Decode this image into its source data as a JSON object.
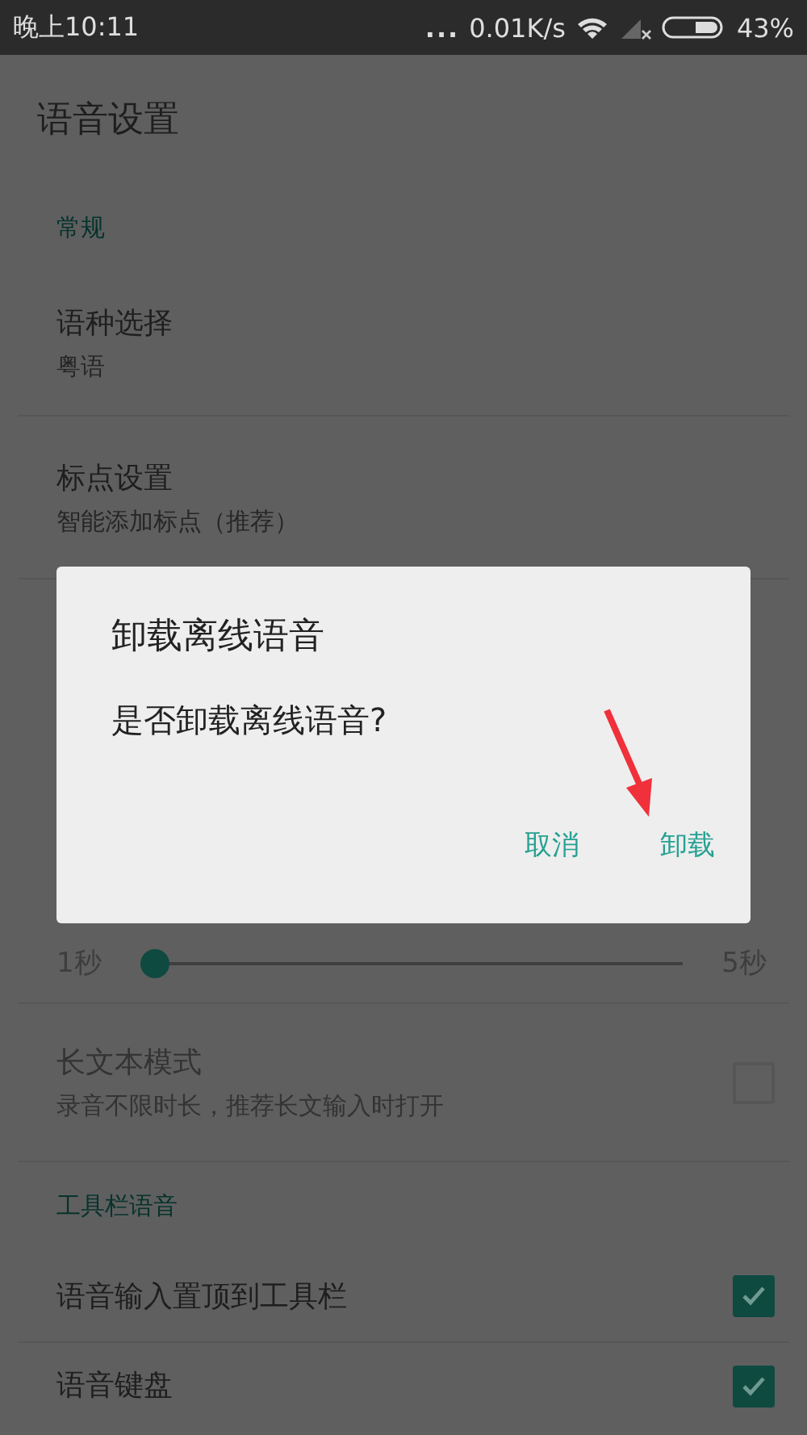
{
  "status_bar": {
    "time": "晚上10:11",
    "more": "...",
    "speed": "0.01K/s",
    "battery": "43%"
  },
  "title": "语音设置",
  "rows": [
    {
      "kind": "header",
      "title": "常规"
    },
    {
      "kind": "item",
      "title": "语种选择",
      "subtitle": "粤语"
    },
    {
      "kind": "item",
      "title": "标点设置",
      "subtitle": "智能添加标点（推荐）"
    },
    {
      "kind": "covered"
    },
    {
      "kind": "slider",
      "min_label": "1秒",
      "max_label": "5秒",
      "level": 0
    },
    {
      "kind": "toggle",
      "title": "长文本模式",
      "subtitle": "录音不限时长，推荐长文输入时打开",
      "checked": false,
      "disabled": true
    },
    {
      "kind": "header",
      "title": "工具栏语音"
    },
    {
      "kind": "toggle",
      "title": "语音输入置顶到工具栏",
      "checked": true,
      "disabled": false
    },
    {
      "kind": "toggle",
      "title": "语音键盘",
      "checked": true,
      "disabled": false
    }
  ],
  "dialog": {
    "title": "卸载离线语音",
    "message": "是否卸载离线语音?",
    "buttons": [
      {
        "label": "取消"
      },
      {
        "label": "卸载"
      }
    ]
  }
}
